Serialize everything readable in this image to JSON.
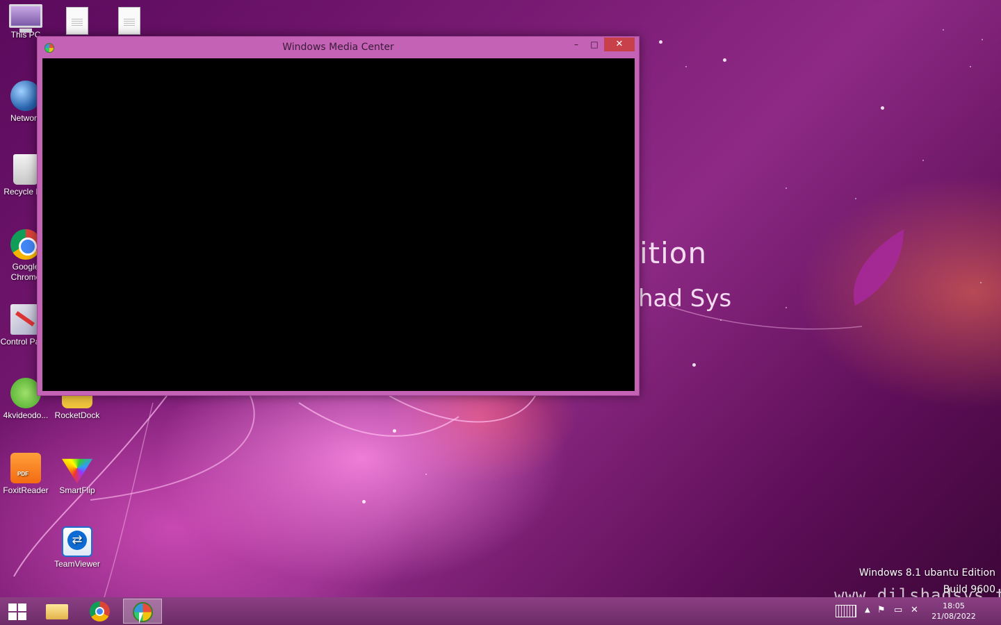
{
  "desktop": {
    "wallpaper_text": {
      "edition_fragment": "ition",
      "sys_fragment": "had Sys"
    },
    "icons": [
      {
        "label": "This PC",
        "icon": "computer-icon"
      },
      {
        "label": "",
        "icon": "document-icon"
      },
      {
        "label": "",
        "icon": "document-icon"
      },
      {
        "label": "Network",
        "icon": "network-globe-icon"
      },
      {
        "label": "Recycle Bin",
        "icon": "recycle-bin-icon"
      },
      {
        "label": "Google Chrome",
        "icon": "chrome-icon"
      },
      {
        "label": "Control Panel",
        "icon": "control-panel-icon"
      },
      {
        "label": "4kvideodo...",
        "icon": "4kvideodownloader-icon"
      },
      {
        "label": "RocketDock",
        "icon": "rocketdock-icon"
      },
      {
        "label": "FoxitReader",
        "icon": "foxit-pdf-icon"
      },
      {
        "label": "SmartFlip",
        "icon": "smartflip-icon"
      },
      {
        "label": "TeamViewer",
        "icon": "teamviewer-icon"
      }
    ],
    "watermark": {
      "edition": "Windows 8.1 ubantu Edition",
      "build": "Build 9600",
      "site": "www.dilshadsys.tk"
    }
  },
  "window": {
    "title": "Windows Media Center",
    "minimize": "–",
    "maximize": "□",
    "close": "✕",
    "titlebar_color": "#c463b6",
    "close_color": "#c7404a"
  },
  "taskbar": {
    "apps": [
      {
        "name": "File Explorer",
        "icon": "folder-icon",
        "active": false
      },
      {
        "name": "Google Chrome",
        "icon": "chrome-icon",
        "active": false
      },
      {
        "name": "Windows Media Center",
        "icon": "media-center-icon",
        "active": true
      }
    ],
    "tray": {
      "up_arrow": "▲",
      "flag": "⚑",
      "network": "▭",
      "volume": "✕"
    },
    "clock": {
      "time": "18:05",
      "date": "21/08/2022"
    },
    "color": "#7a3474"
  }
}
